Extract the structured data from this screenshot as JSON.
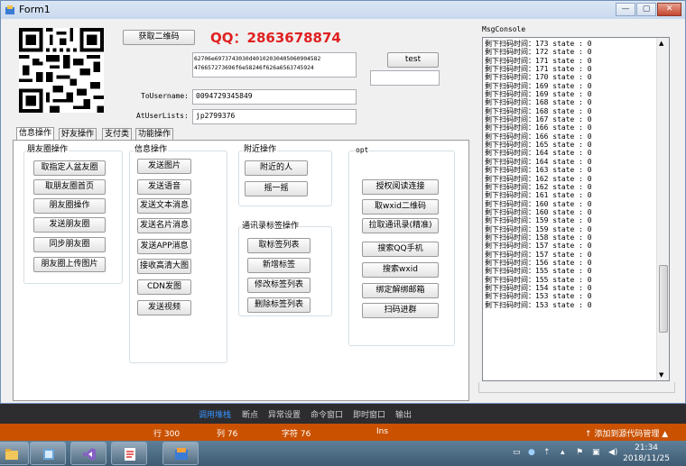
{
  "window": {
    "title": "Form1",
    "controls": [
      "—",
      "▢",
      "✕"
    ]
  },
  "top": {
    "get_qr_label": "获取二维码",
    "qq_text": "QQ：2863678874",
    "hex_line1": "62706e6973743030d40102030405060904582",
    "hex_line2": "476657273696f6e58246f626a6563745924",
    "test_label": "test",
    "to_username_label": "ToUsername:",
    "to_username_value": "0094729345849",
    "at_user_label": "AtUserLists:",
    "at_user_value": "jp2799376"
  },
  "tabs": [
    "信息操作",
    "好友操作",
    "支付类",
    "功能操作"
  ],
  "groups": {
    "moments": {
      "title": "朋友圈操作",
      "buttons": [
        "取指定人盆友圈",
        "取朋友圈首页",
        "朋友圈操作",
        "发送朋友圈",
        "同步朋友圈",
        "朋友圈上传图片"
      ]
    },
    "message": {
      "title": "信息操作",
      "buttons": [
        "发送图片",
        "发送语音",
        "发送文本消息",
        "发送名片消息",
        "发送APP消息",
        "接收高清大图",
        "CDN发图",
        "发送视频"
      ]
    },
    "nearby": {
      "title": "附近操作",
      "buttons": [
        "附近的人",
        "摇一摇"
      ]
    },
    "contacts": {
      "title": "通讯录标签操作",
      "buttons": [
        "取标签列表",
        "新增标签",
        "修改标签列表",
        "删除标签列表"
      ]
    },
    "opt": {
      "title": "opt",
      "buttons": [
        "授权阅读连接",
        "取wxid二维码",
        "拉取通讯录(精准)",
        "搜索QQ手机",
        "搜索wxid",
        "绑定解绑邮箱",
        "扫码进群"
      ]
    }
  },
  "console": {
    "label": "MsgConsole",
    "lines": [
      "剩下扫码时间：173 state : 0",
      "剩下扫码时间：172 state : 0",
      "剩下扫码时间：171 state : 0",
      "剩下扫码时间：171 state : 0",
      "剩下扫码时间：170 state : 0",
      "剩下扫码时间：169 state : 0",
      "剩下扫码时间：169 state : 0",
      "剩下扫码时间：168 state : 0",
      "剩下扫码时间：168 state : 0",
      "剩下扫码时间：167 state : 0",
      "剩下扫码时间：166 state : 0",
      "剩下扫码时间：166 state : 0",
      "剩下扫码时间：165 state : 0",
      "剩下扫码时间：164 state : 0",
      "剩下扫码时间：164 state : 0",
      "剩下扫码时间：163 state : 0",
      "剩下扫码时间：162 state : 0",
      "剩下扫码时间：162 state : 0",
      "剩下扫码时间：161 state : 0",
      "剩下扫码时间：160 state : 0",
      "剩下扫码时间：160 state : 0",
      "剩下扫码时间：159 state : 0",
      "剩下扫码时间：159 state : 0",
      "剩下扫码时间：158 state : 0",
      "剩下扫码时间：157 state : 0",
      "剩下扫码时间：157 state : 0",
      "剩下扫码时间：156 state : 0",
      "剩下扫码时间：155 state : 0",
      "剩下扫码时间：155 state : 0",
      "剩下扫码时间：154 state : 0",
      "剩下扫码时间：153 state : 0",
      "剩下扫码时间：153 state : 0"
    ]
  },
  "vs_tabs": [
    "调用堆栈",
    "断点",
    "异常设置",
    "命令窗口",
    "即时窗口",
    "输出"
  ],
  "vs_status": {
    "line": "行 300",
    "col": "列 76",
    "char": "字符 76",
    "mode": "Ins",
    "source_control": "↑ 添加到源代码管理 ▲"
  },
  "taskbar": {
    "time": "21:34",
    "date": "2018/11/25"
  },
  "colors": {
    "qq_red": "#e02020",
    "status_orange": "#ca5100",
    "vs_dark": "#2d2d30"
  }
}
